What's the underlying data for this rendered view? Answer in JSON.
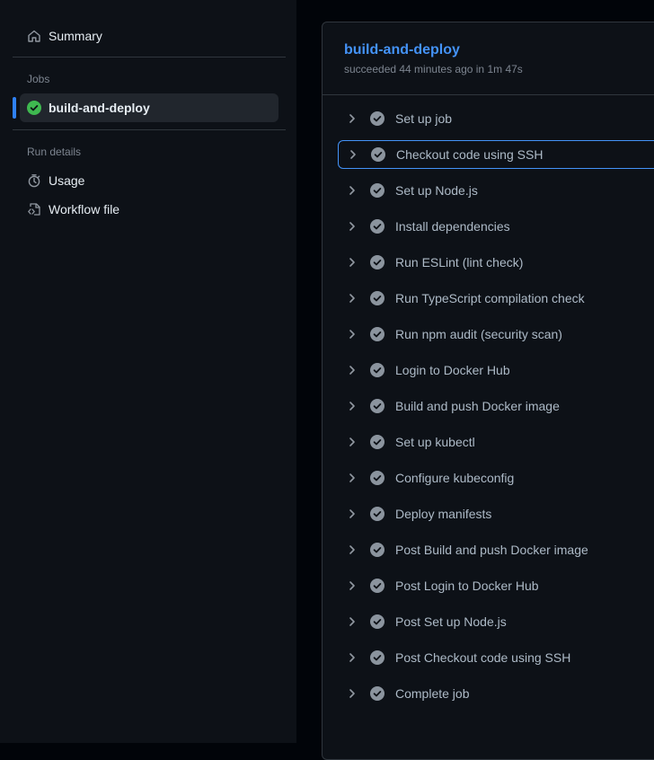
{
  "sidebar": {
    "summary_label": "Summary",
    "jobs_heading": "Jobs",
    "job_label": "build-and-deploy",
    "run_details_heading": "Run details",
    "usage_label": "Usage",
    "workflow_file_label": "Workflow file"
  },
  "job": {
    "title": "build-and-deploy",
    "meta": "succeeded 44 minutes ago in 1m 47s"
  },
  "steps": [
    "Set up job",
    "Checkout code using SSH",
    "Set up Node.js",
    "Install dependencies",
    "Run ESLint (lint check)",
    "Run TypeScript compilation check",
    "Run npm audit (security scan)",
    "Login to Docker Hub",
    "Build and push Docker image",
    "Set up kubectl",
    "Configure kubeconfig",
    "Deploy manifests",
    "Post Build and push Docker image",
    "Post Login to Docker Hub",
    "Post Set up Node.js",
    "Post Checkout code using SSH",
    "Complete job"
  ],
  "icons": {
    "summary": "home-icon",
    "job_status": "check-circle-fill-icon",
    "usage": "stopwatch-icon",
    "workflow_file": "file-code-icon",
    "step_expand": "chevron-right-icon",
    "step_status": "check-circle-icon"
  },
  "colors": {
    "accent": "#4493f8",
    "success": "#3fb950",
    "step_check": "#8b949e"
  }
}
